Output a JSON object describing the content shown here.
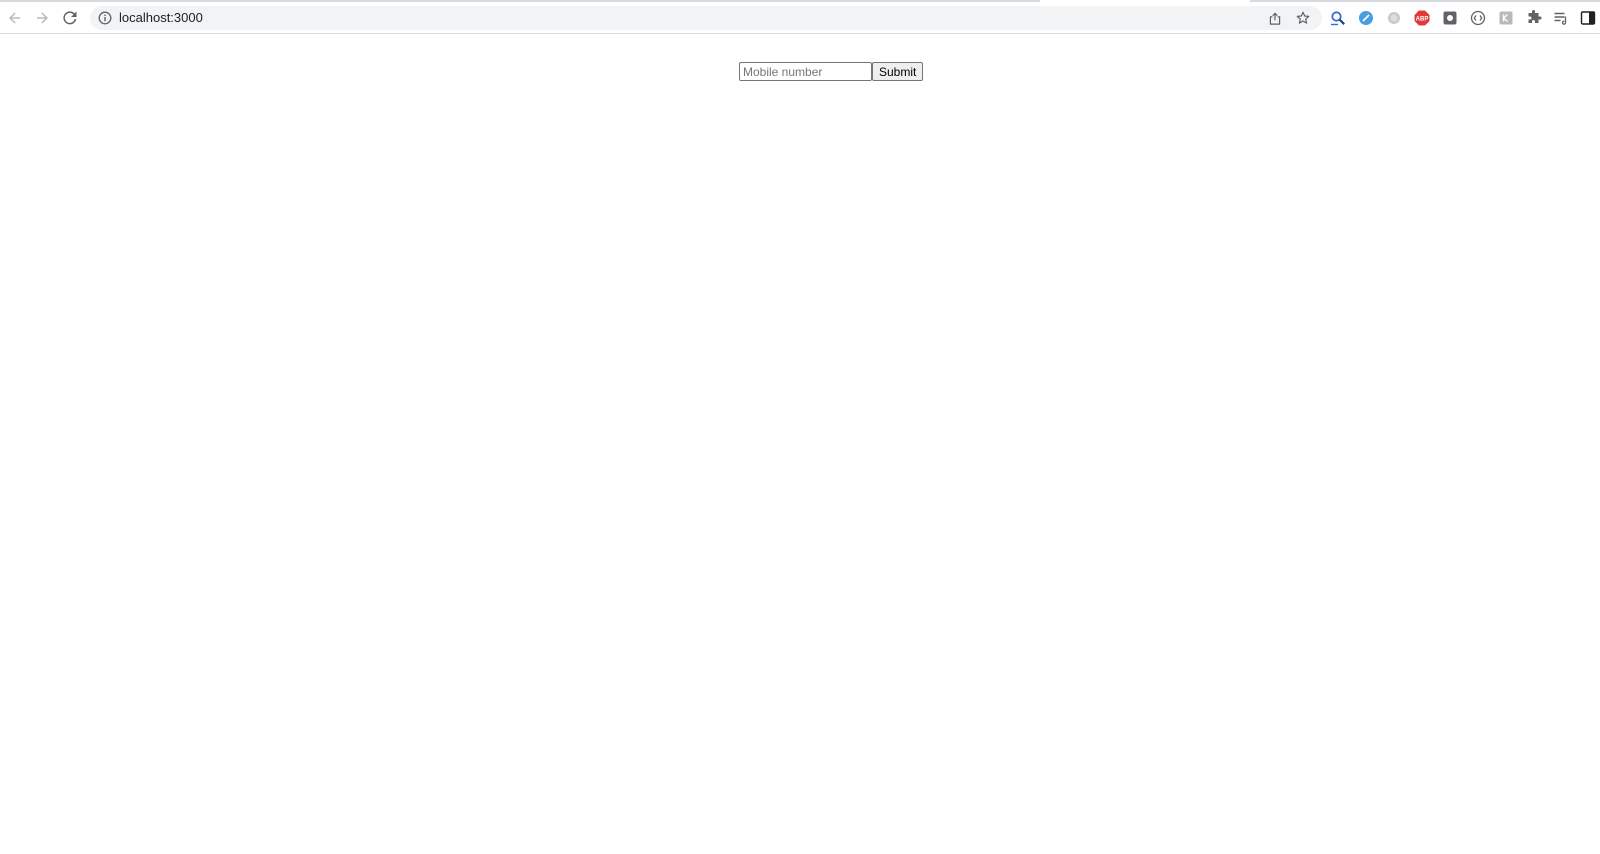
{
  "browser": {
    "url": "localhost:3000",
    "toolbar_icons": [
      "back-icon",
      "forward-icon",
      "reload-icon",
      "site-info-icon",
      "share-icon",
      "bookmark-star-icon"
    ],
    "extensions": [
      {
        "name": "magnifier-extension-icon",
        "color": "#3c6bd1"
      },
      {
        "name": "blue-circle-extension-icon",
        "color": "#4a9ee0"
      },
      {
        "name": "grey-circle-extension-icon",
        "color": "#c7c9cc"
      },
      {
        "name": "adblock-extension-icon",
        "color": "#e03a3a"
      },
      {
        "name": "dark-square-extension-icon",
        "color": "#5f6368"
      },
      {
        "name": "brackets-circle-extension-icon",
        "color": "#5f6368"
      },
      {
        "name": "light-square-extension-icon",
        "color": "#b6b9bd"
      },
      {
        "name": "puzzle-extensions-icon",
        "color": "#5f6368"
      },
      {
        "name": "reading-list-icon",
        "color": "#5f6368"
      },
      {
        "name": "side-panel-icon",
        "color": "#202124"
      }
    ],
    "adblock_label": "ABP"
  },
  "form": {
    "mobile_placeholder": "Mobile number",
    "mobile_value": "",
    "submit_label": "Submit"
  }
}
